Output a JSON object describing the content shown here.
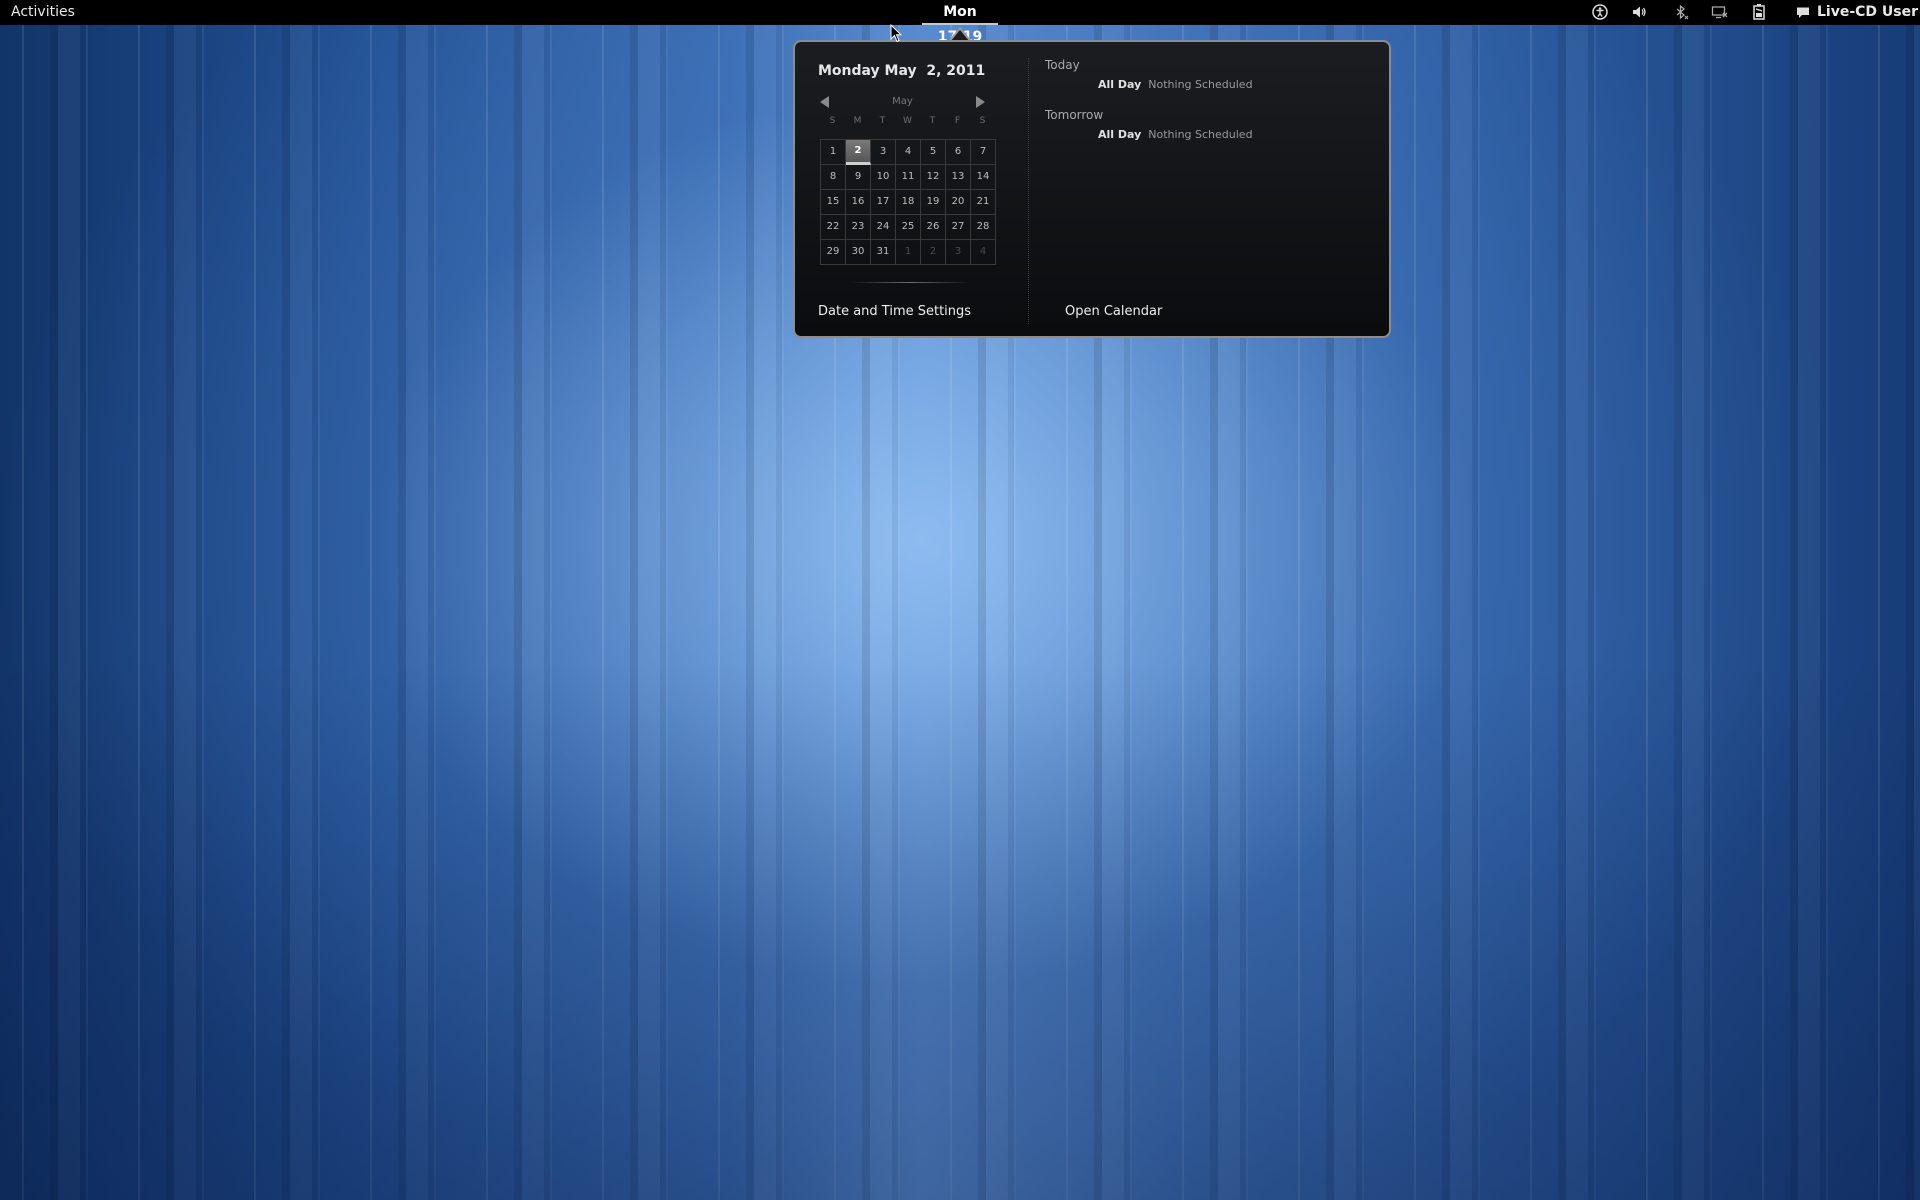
{
  "top_panel": {
    "activities_label": "Activities",
    "clock_label": "Mon 17:19",
    "tray_icons": [
      "accessibility-icon",
      "volume-icon",
      "bluetooth-icon",
      "display-icon",
      "battery-icon",
      "chat-icon"
    ],
    "user_label": "Live-CD User"
  },
  "calendar": {
    "date_heading": "Monday May  2, 2011",
    "month_label": "May",
    "weekdays": [
      "S",
      "M",
      "T",
      "W",
      "T",
      "F",
      "S"
    ],
    "selected_day": 2,
    "days": [
      {
        "label": "1",
        "current": true
      },
      {
        "label": "2",
        "current": true
      },
      {
        "label": "3",
        "current": true
      },
      {
        "label": "4",
        "current": true
      },
      {
        "label": "5",
        "current": true
      },
      {
        "label": "6",
        "current": true
      },
      {
        "label": "7",
        "current": true
      },
      {
        "label": "8",
        "current": true
      },
      {
        "label": "9",
        "current": true
      },
      {
        "label": "10",
        "current": true
      },
      {
        "label": "11",
        "current": true
      },
      {
        "label": "12",
        "current": true
      },
      {
        "label": "13",
        "current": true
      },
      {
        "label": "14",
        "current": true
      },
      {
        "label": "15",
        "current": true
      },
      {
        "label": "16",
        "current": true
      },
      {
        "label": "17",
        "current": true
      },
      {
        "label": "18",
        "current": true
      },
      {
        "label": "19",
        "current": true
      },
      {
        "label": "20",
        "current": true
      },
      {
        "label": "21",
        "current": true
      },
      {
        "label": "22",
        "current": true
      },
      {
        "label": "23",
        "current": true
      },
      {
        "label": "24",
        "current": true
      },
      {
        "label": "25",
        "current": true
      },
      {
        "label": "26",
        "current": true
      },
      {
        "label": "27",
        "current": true
      },
      {
        "label": "28",
        "current": true
      },
      {
        "label": "29",
        "current": true
      },
      {
        "label": "30",
        "current": true
      },
      {
        "label": "31",
        "current": true
      },
      {
        "label": "1",
        "current": false
      },
      {
        "label": "2",
        "current": false
      },
      {
        "label": "3",
        "current": false
      },
      {
        "label": "4",
        "current": false
      }
    ],
    "settings_button": "Date and Time Settings"
  },
  "events": {
    "today_title": "Today",
    "today_time": "All Day",
    "today_text": "Nothing Scheduled",
    "tomorrow_title": "Tomorrow",
    "tomorrow_time": "All Day",
    "tomorrow_text": "Nothing Scheduled",
    "open_button": "Open Calendar"
  }
}
